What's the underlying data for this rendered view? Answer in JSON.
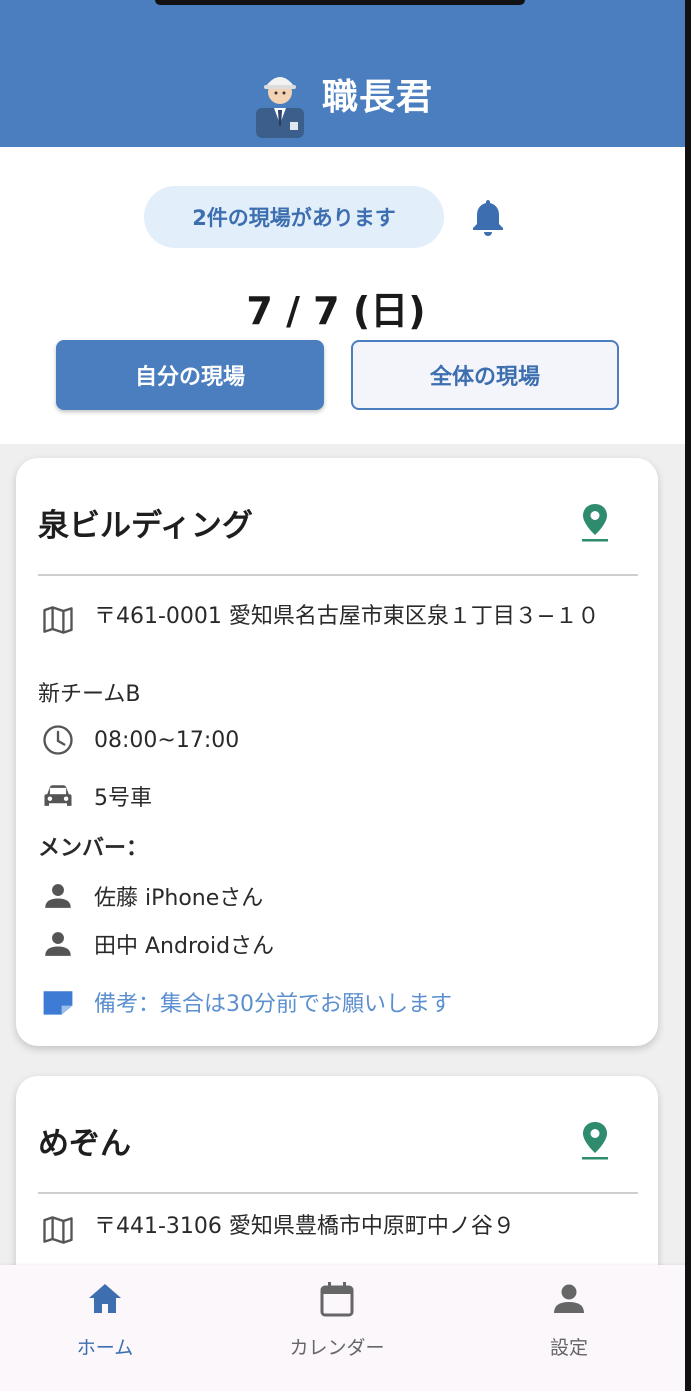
{
  "header": {
    "app_title": "職長君",
    "mascot_icon": "worker-mascot-icon"
  },
  "notice": {
    "text": "2件の現場があります",
    "icon": "bell-icon"
  },
  "date": "7 / 7 (日)",
  "tabs": {
    "mine": "自分の現場",
    "all": "全体の現場"
  },
  "colors": {
    "primary": "#4a7ebf",
    "pin": "#2e8b6e",
    "note": "#5b8fcf"
  },
  "sites": [
    {
      "name": "泉ビルディング",
      "address": "〒461-0001 愛知県名古屋市東区泉１丁目３−１０",
      "team": "新チームB",
      "time": "08:00~17:00",
      "vehicle": "5号車",
      "members_label": "メンバー：",
      "members": [
        "佐藤 iPhoneさん",
        "田中 Androidさん"
      ],
      "note": "備考：集合は30分前でお願いします"
    },
    {
      "name": "めぞん",
      "address": "〒441-3106 愛知県豊橋市中原町中ノ谷９"
    }
  ],
  "nav": [
    {
      "label": "ホーム",
      "icon": "home-icon"
    },
    {
      "label": "カレンダー",
      "icon": "calendar-icon"
    },
    {
      "label": "設定",
      "icon": "person-icon"
    }
  ]
}
